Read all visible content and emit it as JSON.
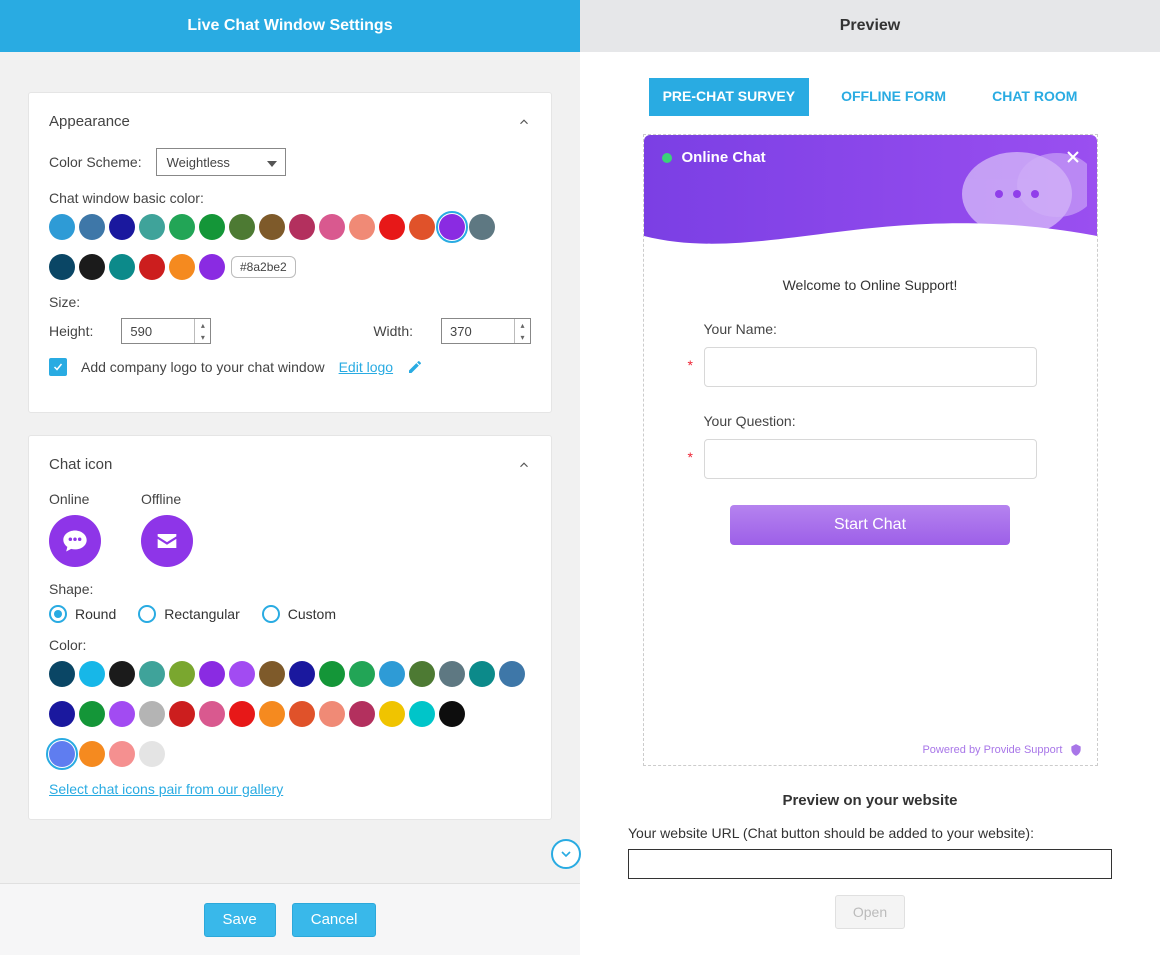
{
  "left": {
    "title": "Live Chat Window Settings",
    "appearance": {
      "section": "Appearance",
      "color_scheme_label": "Color Scheme:",
      "color_scheme_value": "Weightless",
      "basic_color_label": "Chat window basic color:",
      "basic_colors_row1": [
        "#2e9bd6",
        "#3e77a8",
        "#1a189e",
        "#3fa39a",
        "#22a556",
        "#149638",
        "#4d7a33",
        "#7e5a2a",
        "#b3305e",
        "#d9598f",
        "#f08a76",
        "#e71818",
        "#e0522a",
        "#8a2be2",
        "#5e7882"
      ],
      "basic_colors_row2": [
        "#0a4665",
        "#1b1b1b",
        "#0c8a8a",
        "#cc1e1e",
        "#f58a1f",
        "#8a2be2"
      ],
      "selected_basic_color_index_row1": 13,
      "selected_color_tooltip": "#8a2be2",
      "size_label": "Size:",
      "height_label": "Height:",
      "height_value": "590",
      "width_label": "Width:",
      "width_value": "370",
      "logo_checked": true,
      "logo_text": "Add company logo to your chat window",
      "edit_logo": "Edit logo"
    },
    "chaticon": {
      "section": "Chat icon",
      "online_label": "Online",
      "offline_label": "Offline",
      "shape_label": "Shape:",
      "shape_options": [
        "Round",
        "Rectangular",
        "Custom"
      ],
      "shape_selected": "Round",
      "color_label": "Color:",
      "colors_row1": [
        "#0a4665",
        "#17b7e8",
        "#1b1b1b",
        "#3fa39a",
        "#7aa72f",
        "#8a2be2",
        "#a24bf2",
        "#7e5a2a",
        "#1a189e",
        "#149638",
        "#22a556",
        "#2e9bd6",
        "#4d7a33",
        "#5e7882",
        "#0c8a8a",
        "#3e77a8"
      ],
      "colors_row2": [
        "#1a189e",
        "#149638",
        "#a24bf2",
        "#b4b4b4",
        "#cc1e1e",
        "#d9598f",
        "#e71818",
        "#f58a1f",
        "#e0522a",
        "#f08a76",
        "#b3305e",
        "#f0c400",
        "#00c5c9",
        "#0d0d0d"
      ],
      "colors_row3": [
        "#5f7df0",
        "#f58a1f",
        "#f59090",
        "#e4e4e4"
      ],
      "selected_row3_index": 0,
      "gallery_link": "Select chat icons pair from our gallery"
    },
    "footer": {
      "save": "Save",
      "cancel": "Cancel"
    }
  },
  "right": {
    "title": "Preview",
    "tabs": [
      "PRE-CHAT SURVEY",
      "OFFLINE FORM",
      "CHAT ROOM"
    ],
    "active_tab": 0,
    "chat": {
      "window_title": "Online Chat",
      "welcome": "Welcome to Online Support!",
      "name_label": "Your Name:",
      "question_label": "Your Question:",
      "start": "Start Chat",
      "powered": "Powered by Provide Support"
    },
    "preview_label": "Preview on your website",
    "url_label": "Your website URL (Chat button should be added to your website):",
    "open": "Open"
  }
}
